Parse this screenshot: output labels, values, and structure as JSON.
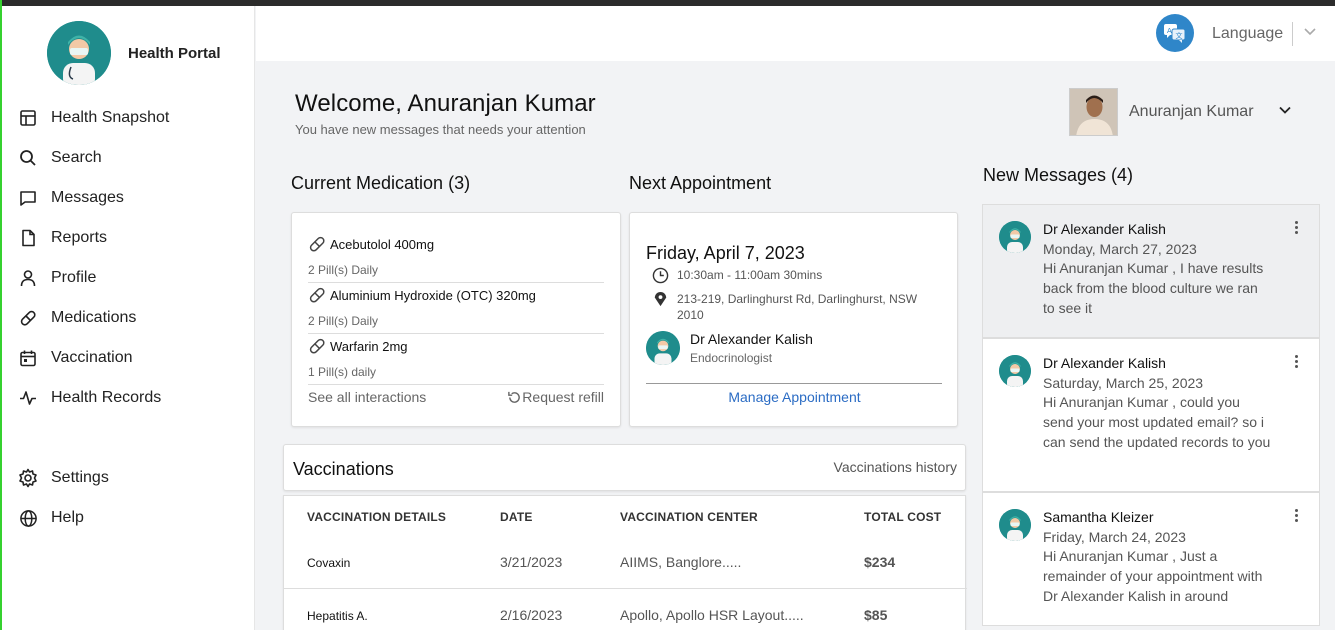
{
  "sidebar": {
    "brand_title": "Health Portal",
    "items": [
      {
        "label": "Health Snapshot",
        "icon": "grid-icon"
      },
      {
        "label": "Search",
        "icon": "search-icon"
      },
      {
        "label": "Messages",
        "icon": "message-icon"
      },
      {
        "label": "Reports",
        "icon": "document-icon"
      },
      {
        "label": "Profile",
        "icon": "user-icon"
      },
      {
        "label": "Medications",
        "icon": "pill-icon"
      },
      {
        "label": "Vaccination",
        "icon": "calendar-icon"
      },
      {
        "label": "Health Records",
        "icon": "pulse-icon"
      }
    ],
    "bottom_items": [
      {
        "label": "Settings",
        "icon": "gear-icon"
      },
      {
        "label": "Help",
        "icon": "globe-icon"
      }
    ]
  },
  "header": {
    "language_label": "Language"
  },
  "welcome": {
    "title": "Welcome, Anuranjan Kumar",
    "subtitle": "You have new messages that needs your attention"
  },
  "user": {
    "name": "Anuranjan Kumar"
  },
  "medication": {
    "title": "Current Medication (3)",
    "items": [
      {
        "name": "Acebutolol 400mg",
        "dose": "2 Pill(s) Daily"
      },
      {
        "name": "Aluminium Hydroxide (OTC) 320mg",
        "dose": "2 Pill(s) Daily"
      },
      {
        "name": "Warfarin 2mg",
        "dose": "1 Pill(s) daily"
      }
    ],
    "see_all": "See all interactions",
    "refill": "Request refill"
  },
  "appointment": {
    "title": "Next Appointment",
    "date": "Friday, April 7, 2023",
    "time": "10:30am - 11:00am 30mins",
    "address": "213-219, Darlinghurst Rd, Darlinghurst, NSW 2010",
    "doctor": "Dr Alexander Kalish",
    "specialty": "Endocrinologist",
    "manage": "Manage Appointment"
  },
  "vaccinations": {
    "title": "Vaccinations",
    "history": "Vaccinations history",
    "columns": [
      "VACCINATION DETAILS",
      "DATE",
      "VACCINATION CENTER",
      "TOTAL COST"
    ],
    "rows": [
      {
        "name": "Covaxin",
        "date": "3/21/2023",
        "center": "AIIMS, Banglore.....",
        "cost": "$234"
      },
      {
        "name": "Hepatitis A.",
        "date": "2/16/2023",
        "center": "Apollo, Apollo HSR Layout.....",
        "cost": "$85"
      }
    ]
  },
  "messages": {
    "title": "New Messages (4)",
    "items": [
      {
        "from": "Dr Alexander Kalish",
        "date": "Monday, March 27, 2023",
        "text": "Hi Anuranjan Kumar , I have results back from the blood culture we ran to see it"
      },
      {
        "from": "Dr Alexander Kalish",
        "date": "Saturday, March 25, 2023",
        "text": "Hi Anuranjan Kumar , could you send your most updated email? so i can send the updated records to you"
      },
      {
        "from": "Samantha Kleizer",
        "date": "Friday, March 24, 2023",
        "text": "Hi Anuranjan Kumar , Just a remainder of your appointment with Dr Alexander Kalish in around"
      }
    ]
  },
  "colors": {
    "brand_teal": "#1f8c8c",
    "link_blue": "#2b6cc4",
    "language_blue": "#2f86c9"
  }
}
